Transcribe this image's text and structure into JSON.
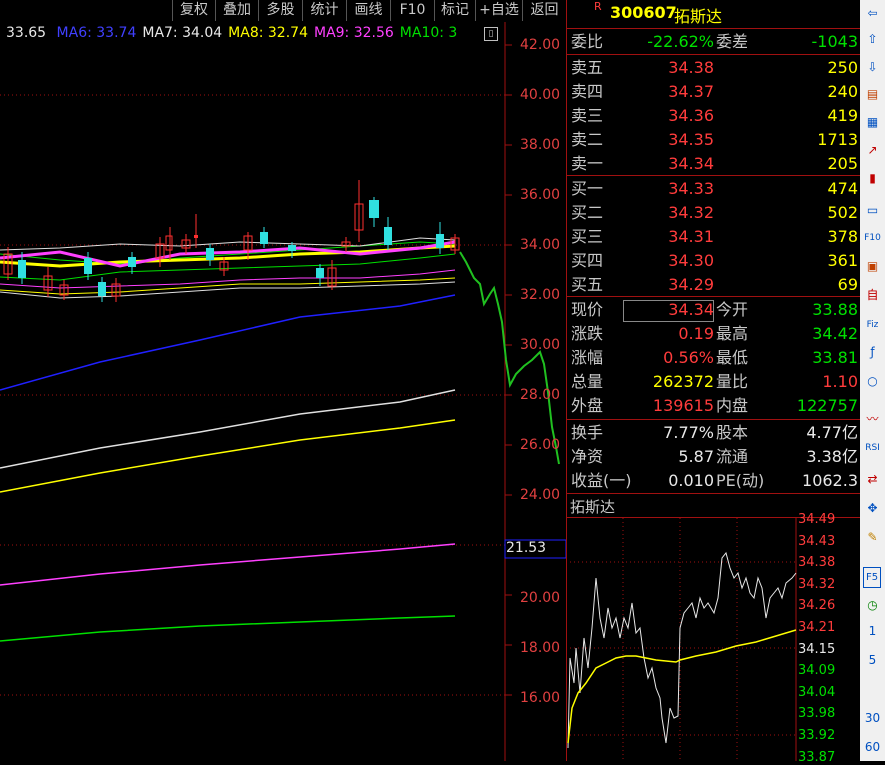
{
  "toolbar": {
    "buttons": [
      "复权",
      "叠加",
      "多股",
      "统计",
      "画线",
      "F10",
      "标记",
      "+自选",
      "返回"
    ]
  },
  "ma_legend": {
    "first_value": "33.65",
    "items": [
      {
        "label": "MA6: 33.74",
        "color": "#4040ff"
      },
      {
        "label": "MA7: 34.04",
        "color": "#e8e8e8"
      },
      {
        "label": "MA8: 32.74",
        "color": "#ffff00"
      },
      {
        "label": "MA9: 32.56",
        "color": "#ff40ff"
      },
      {
        "label": "MA10: 3",
        "color": "#00e000"
      }
    ]
  },
  "price_axis": {
    "ticks": [
      "42.00",
      "40.00",
      "38.00",
      "36.00",
      "34.00",
      "32.00",
      "30.00",
      "28.00",
      "26.00",
      "24.00",
      "20.00",
      "18.00",
      "16.00"
    ],
    "highlight": "21.53"
  },
  "quote": {
    "code_badge": "R",
    "code": "300607",
    "name": "拓斯达",
    "weibi_label": "委比",
    "weibi_value": "-22.62%",
    "weicha_label": "委差",
    "weicha_value": "-1043",
    "sell": [
      {
        "label": "卖五",
        "price": "34.38",
        "vol": "250"
      },
      {
        "label": "卖四",
        "price": "34.37",
        "vol": "240"
      },
      {
        "label": "卖三",
        "price": "34.36",
        "vol": "419"
      },
      {
        "label": "卖二",
        "price": "34.35",
        "vol": "1713"
      },
      {
        "label": "卖一",
        "price": "34.34",
        "vol": "205"
      }
    ],
    "buy": [
      {
        "label": "买一",
        "price": "34.33",
        "vol": "474"
      },
      {
        "label": "买二",
        "price": "34.32",
        "vol": "502"
      },
      {
        "label": "买三",
        "price": "34.31",
        "vol": "378"
      },
      {
        "label": "买四",
        "price": "34.30",
        "vol": "361"
      },
      {
        "label": "买五",
        "price": "34.29",
        "vol": "69"
      }
    ],
    "stats": [
      {
        "l1": "现价",
        "v1": "34.34",
        "c1": "red",
        "l2": "今开",
        "v2": "33.88",
        "c2": "green"
      },
      {
        "l1": "涨跌",
        "v1": "0.19",
        "c1": "red",
        "l2": "最高",
        "v2": "34.42",
        "c2": "green"
      },
      {
        "l1": "涨幅",
        "v1": "0.56%",
        "c1": "red",
        "l2": "最低",
        "v2": "33.81",
        "c2": "green"
      },
      {
        "l1": "总量",
        "v1": "262372",
        "c1": "yellow",
        "l2": "量比",
        "v2": "1.10",
        "c2": "red"
      },
      {
        "l1": "外盘",
        "v1": "139615",
        "c1": "red",
        "l2": "内盘",
        "v2": "122757",
        "c2": "green"
      }
    ],
    "stats2": [
      {
        "l1": "换手",
        "v1": "7.77%",
        "l2": "股本",
        "v2": "4.77亿"
      },
      {
        "l1": "净资",
        "v1": "5.87",
        "l2": "流通",
        "v2": "3.38亿"
      },
      {
        "l1": "收益(一)",
        "v1": "0.010",
        "l2": "PE(动)",
        "v2": "1062.3"
      }
    ]
  },
  "mini_chart": {
    "title": "拓斯达",
    "ticks": [
      "34.49",
      "34.43",
      "34.38",
      "34.32",
      "34.26",
      "34.21",
      "34.15",
      "34.09",
      "34.04",
      "33.98",
      "33.92",
      "33.87"
    ]
  },
  "sidebar": {
    "bottom_labels": [
      "F5",
      "1",
      "5",
      "30",
      "60"
    ]
  }
}
